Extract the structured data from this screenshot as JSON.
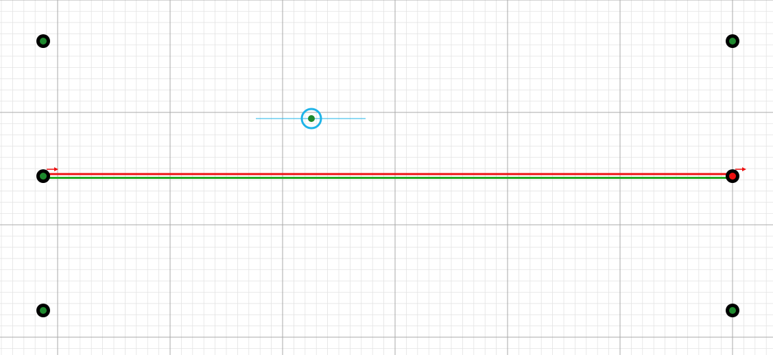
{
  "canvas": {
    "background": "#ffffff",
    "grid": {
      "minor_color": "#e3e3e3",
      "major_color": "#a8a8a8"
    }
  },
  "track": {
    "red_line_color": "#ee1111",
    "green_line_color": "#22aa22"
  },
  "nodes": {
    "outer_color": "#000000",
    "inner_color": "#1e8a2e",
    "endpoint_active_color": "#ee1111"
  },
  "selection_handle": {
    "ring_color": "#1fb4e8",
    "guide_color": "#1fb4e8",
    "center_color": "#1e8a2e"
  },
  "icons": {
    "direction_arrow": "direction-arrow-icon",
    "handle": "selection-handle-icon"
  }
}
